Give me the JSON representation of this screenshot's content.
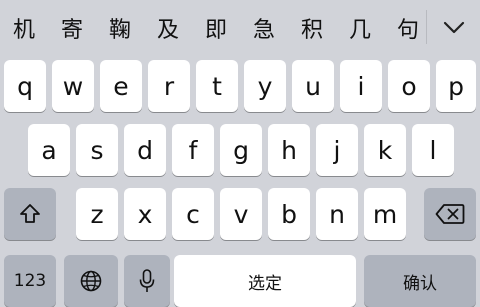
{
  "candidates": [
    "机",
    "寄",
    "鞠",
    "及",
    "即",
    "急",
    "积",
    "几",
    "句"
  ],
  "collapse_icon": "chevron-down-icon",
  "rows": [
    [
      "q",
      "w",
      "e",
      "r",
      "t",
      "y",
      "u",
      "i",
      "o",
      "p"
    ],
    [
      "a",
      "s",
      "d",
      "f",
      "g",
      "h",
      "j",
      "k",
      "l"
    ],
    [
      "z",
      "x",
      "c",
      "v",
      "b",
      "n",
      "m"
    ]
  ],
  "bottom": {
    "numbers_label": "123",
    "globe_icon": "globe-icon",
    "mic_icon": "microphone-icon",
    "space_label": "选定",
    "return_label": "确认"
  },
  "shift_icon": "shift-icon",
  "delete_icon": "delete-icon",
  "colors": {
    "background": "#d1d3d9",
    "key": "#ffffff",
    "function_key": "#aeb3bd"
  }
}
